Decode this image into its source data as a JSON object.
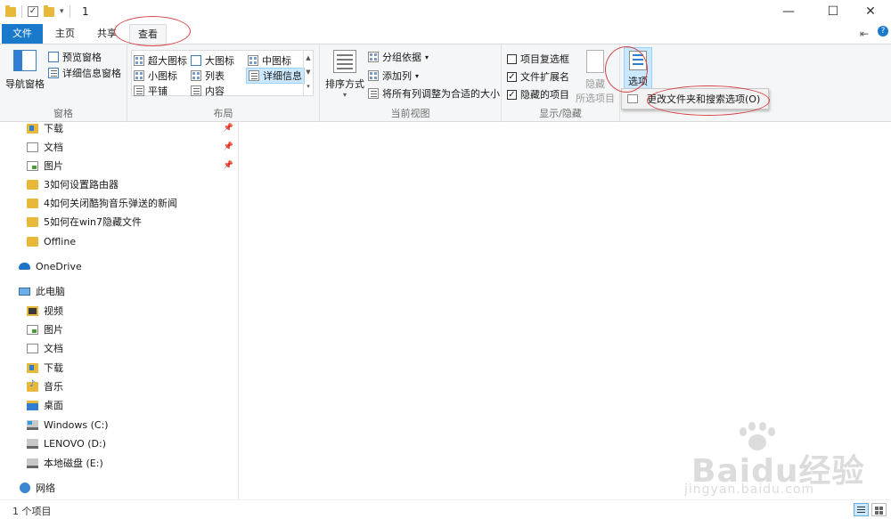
{
  "window": {
    "title": "1",
    "minimize": "—",
    "maximize": "☐",
    "close": "✕"
  },
  "tabs": {
    "file": "文件",
    "home": "主页",
    "share": "共享",
    "view": "查看",
    "pin_glyph": "⇤",
    "help_glyph": "?"
  },
  "ribbon": {
    "panes": {
      "nav_pane": "导航窗格",
      "preview_pane": "预览窗格",
      "details_pane": "详细信息窗格",
      "label": "窗格"
    },
    "layout": {
      "extra_large_icons": "超大图标",
      "large_icons": "大图标",
      "medium_icons": "中图标",
      "small_icons": "小图标",
      "list": "列表",
      "details": "详细信息",
      "tiles": "平铺",
      "content": "内容",
      "label": "布局"
    },
    "current_view": {
      "sort_by": "排序方式",
      "group_by": "分组依据",
      "add_columns": "添加列",
      "size_all_columns": "将所有列调整为合适的大小",
      "label": "当前视图"
    },
    "show_hide": {
      "item_checkboxes": "项目复选框",
      "item_checkboxes_checked": false,
      "file_extensions": "文件扩展名",
      "file_extensions_checked": true,
      "hidden_items": "隐藏的项目",
      "hidden_items_checked": true,
      "hide_selected_line1": "隐藏",
      "hide_selected_line2": "所选项目",
      "label": "显示/隐藏"
    },
    "options": {
      "label": "选项"
    }
  },
  "dropdown": {
    "change_folder_options": "更改文件夹和搜索选项(O)"
  },
  "nav": {
    "quick_access": [
      {
        "label": "下载",
        "pinned": true
      },
      {
        "label": "文档",
        "pinned": true
      },
      {
        "label": "图片",
        "pinned": true
      },
      {
        "label": "3如何设置路由器",
        "pinned": false
      },
      {
        "label": "4如何关闭酷狗音乐弹送的新闻",
        "pinned": false
      },
      {
        "label": "5如何在win7隐藏文件",
        "pinned": false
      },
      {
        "label": "Offline",
        "pinned": false
      }
    ],
    "onedrive": "OneDrive",
    "this_pc": "此电脑",
    "pc_items": [
      {
        "label": "视频"
      },
      {
        "label": "图片"
      },
      {
        "label": "文档"
      },
      {
        "label": "下载"
      },
      {
        "label": "音乐"
      },
      {
        "label": "桌面"
      },
      {
        "label": "Windows (C:)"
      },
      {
        "label": "LENOVO (D:)"
      },
      {
        "label": "本地磁盘 (E:)"
      }
    ],
    "network": "网络",
    "pin_glyph": "📌"
  },
  "status": {
    "item_count": "1 个项目"
  },
  "watermark": {
    "brand": "Baidu经验",
    "url": "jingyan.baidu.com"
  }
}
